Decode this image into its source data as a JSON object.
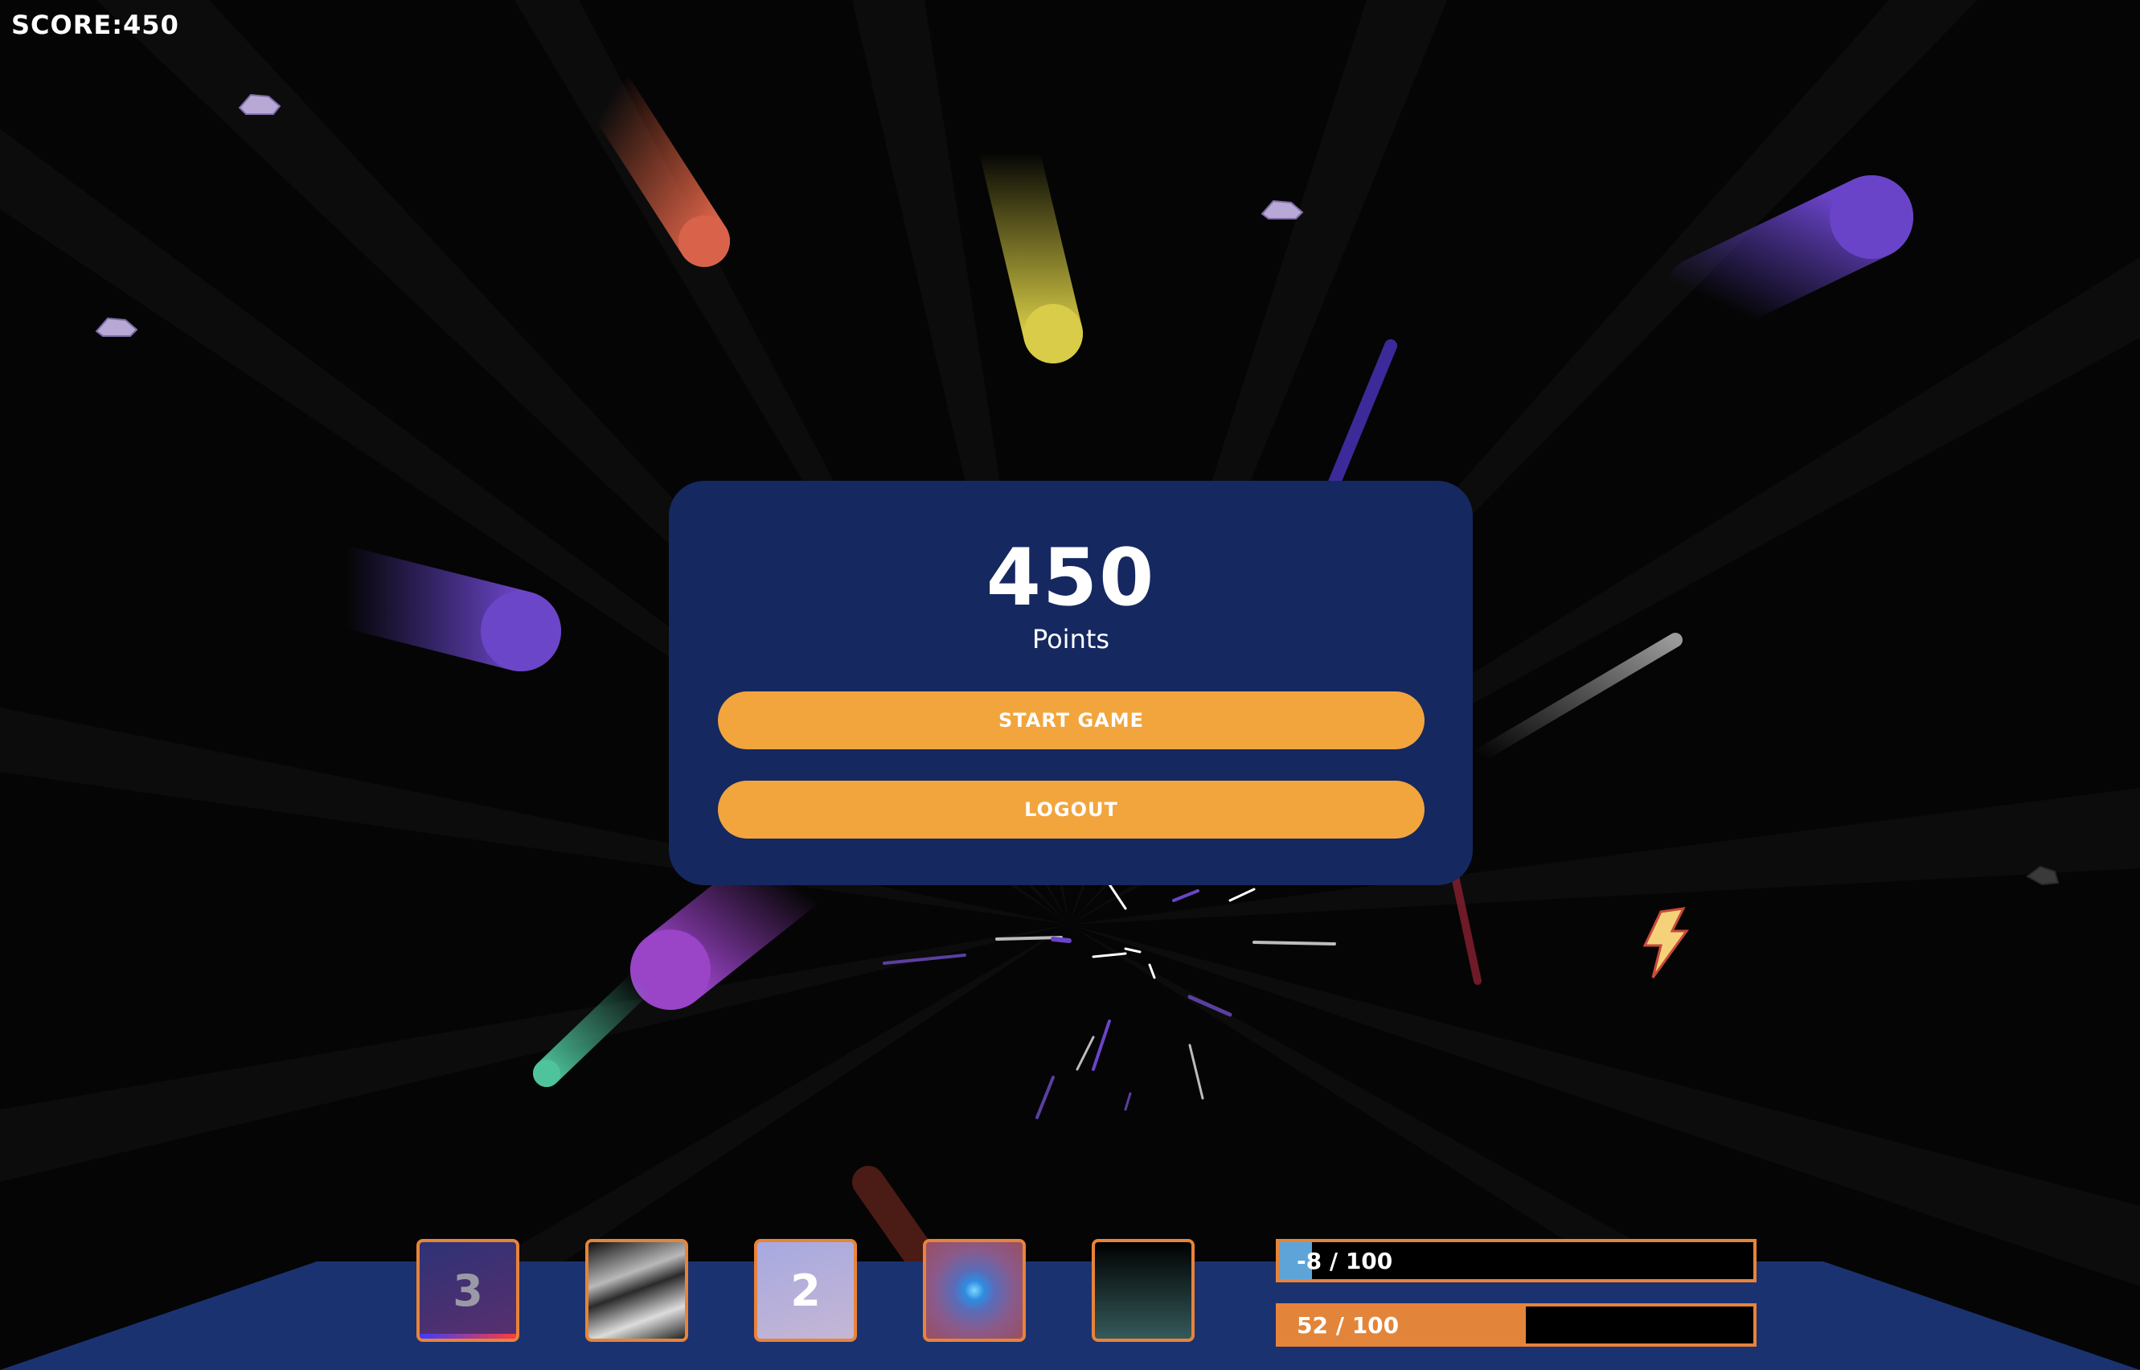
{
  "hud": {
    "score_text": "SCORE:450"
  },
  "menu": {
    "score": "450",
    "points_label": "Points",
    "start_label": "START GAME",
    "logout_label": "LOGOUT"
  },
  "inventory": {
    "slots": [
      {
        "name": "slot-1",
        "count": "3"
      },
      {
        "name": "slot-2",
        "count": ""
      },
      {
        "name": "slot-3",
        "count": "2"
      },
      {
        "name": "slot-4",
        "count": ""
      },
      {
        "name": "slot-5",
        "count": ""
      }
    ]
  },
  "bars": [
    {
      "label": "-8 / 100",
      "value": -8,
      "max": 100,
      "fill_fraction": 0.07,
      "color": "#5ea4d8"
    },
    {
      "label": "52 / 100",
      "value": 52,
      "max": 100,
      "fill_fraction": 0.52,
      "color": "#e2853a"
    }
  ],
  "colors": {
    "panel": "#152860",
    "button": "#f2a53d",
    "accent": "#e8833a",
    "dock": "#1a3270"
  }
}
